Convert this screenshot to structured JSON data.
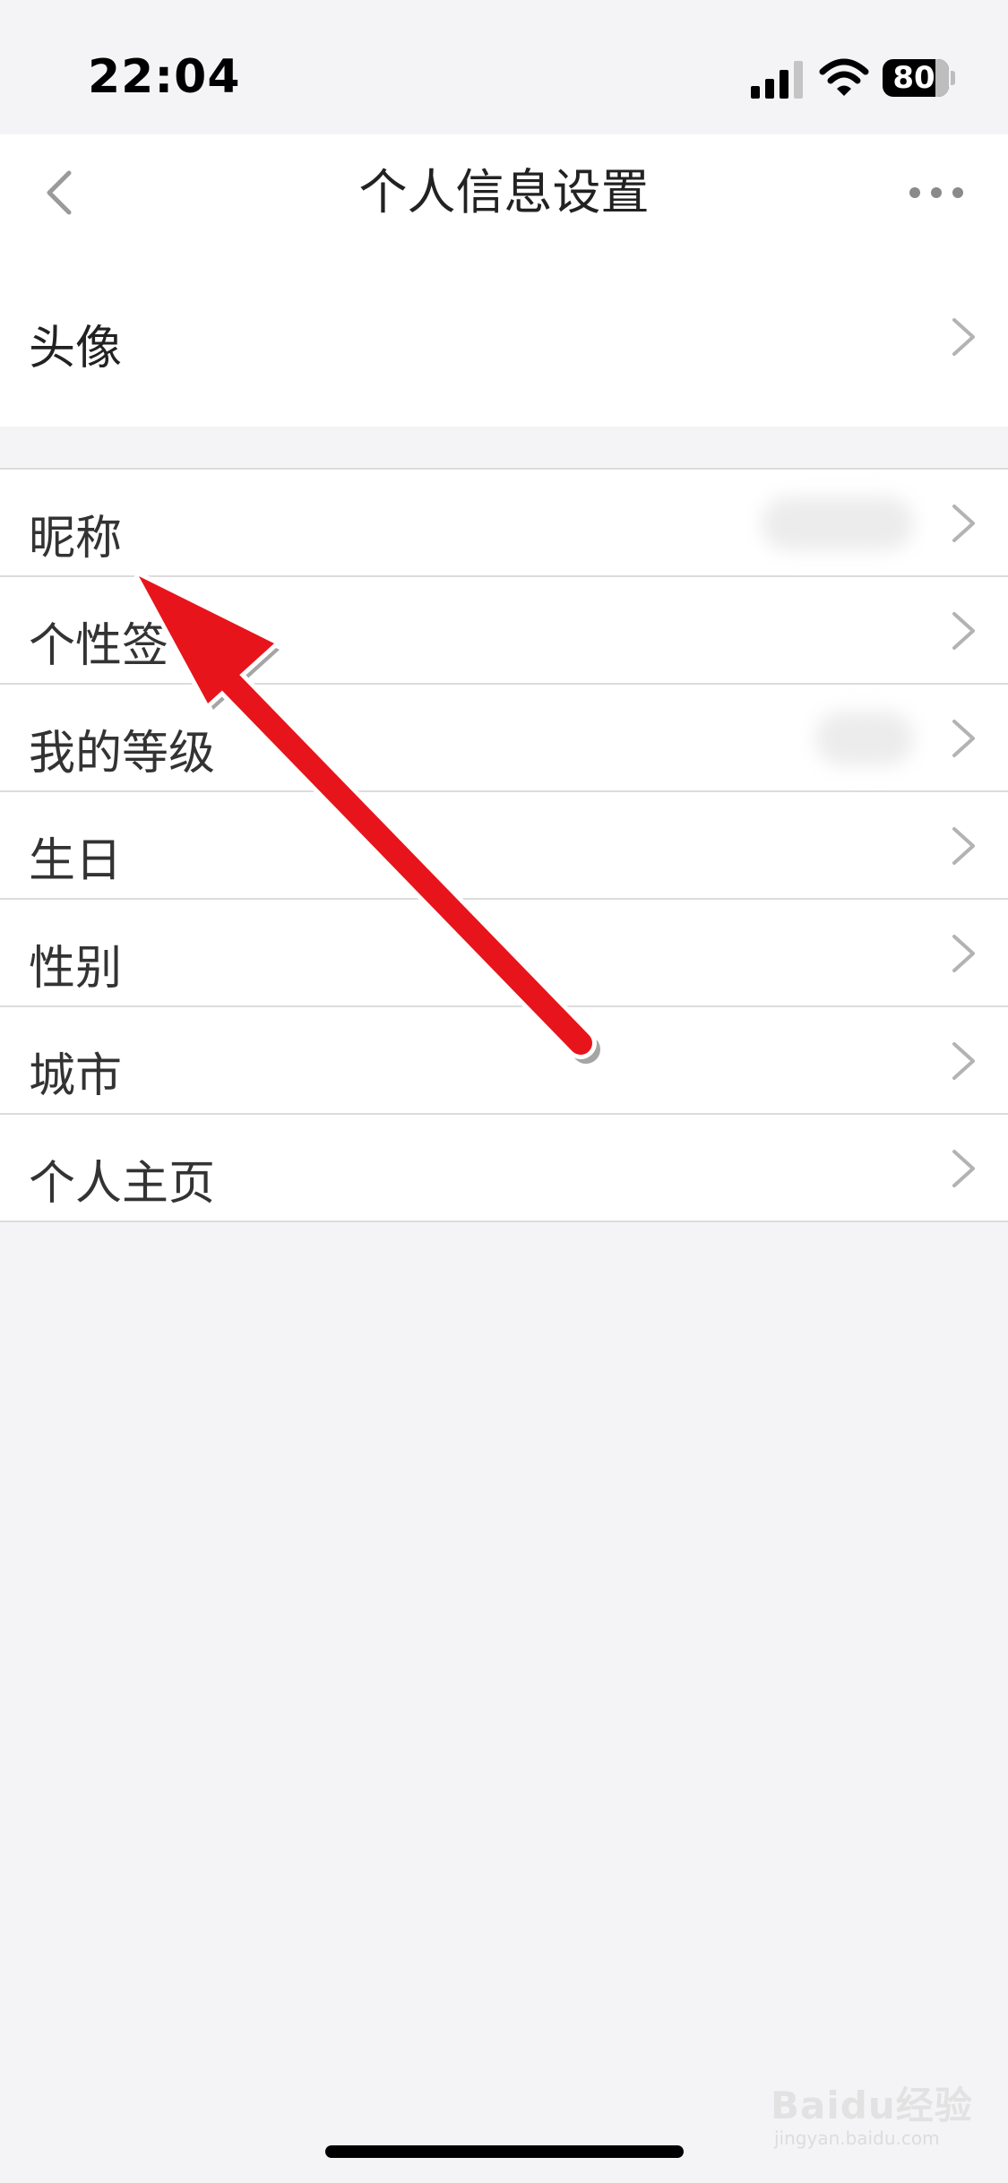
{
  "status_bar": {
    "time": "22:04",
    "battery_level": "80",
    "battery_fraction": 0.8,
    "signal_icon": "cellular-signal-icon",
    "wifi_icon": "wifi-icon"
  },
  "nav": {
    "title": "个人信息设置",
    "back_icon": "chevron-left-icon",
    "more_icon": "more-dots-icon"
  },
  "avatar_row": {
    "label": "头像"
  },
  "list": [
    {
      "label": "昵称"
    },
    {
      "label": "个性签"
    },
    {
      "label": "我的等级"
    },
    {
      "label": "生日"
    },
    {
      "label": "性别"
    },
    {
      "label": "城市"
    },
    {
      "label": "个人主页"
    }
  ],
  "watermark": {
    "main": "Baidu经验",
    "sub": "jingyan.baidu.com"
  },
  "colors": {
    "background": "#f4f4f6",
    "row_background": "#ffffff",
    "divider": "#dcdcdc",
    "chevron": "#b3b3b3",
    "annotation_arrow": "#e8141b"
  }
}
